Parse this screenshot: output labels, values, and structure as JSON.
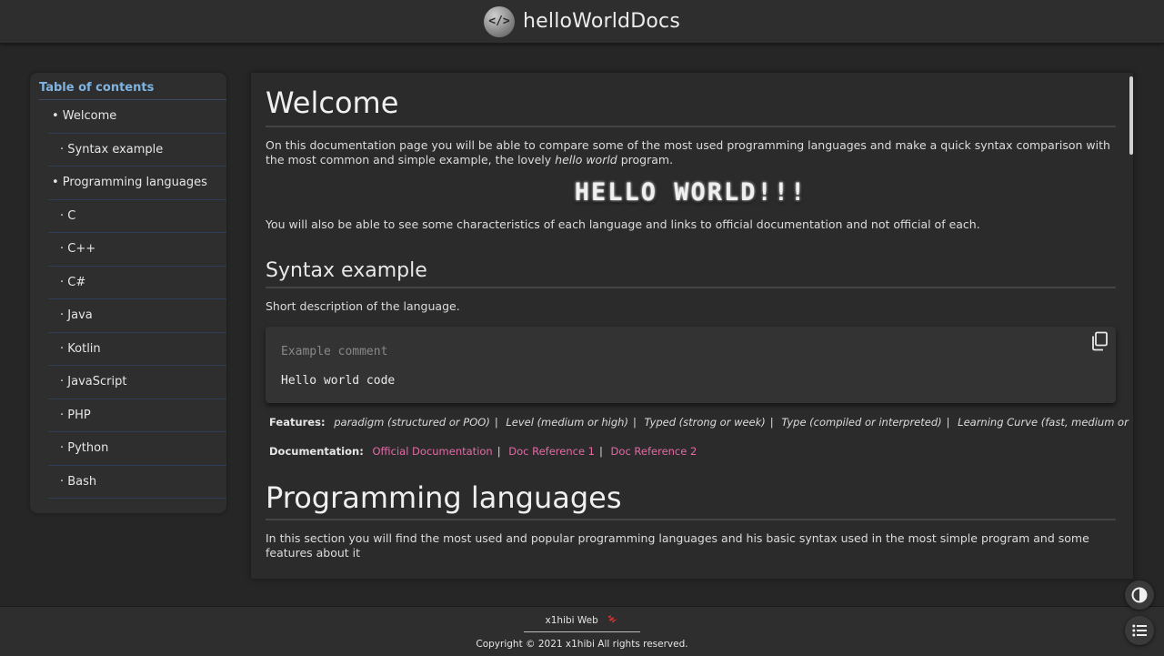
{
  "header": {
    "logo_glyph": "</>",
    "brand": "helloWorldDocs"
  },
  "toc": {
    "title": "Table of contents",
    "items": [
      {
        "label": "• Welcome",
        "level": 1
      },
      {
        "label": "· Syntax example",
        "level": 2
      },
      {
        "label": "• Programming languages",
        "level": 1
      },
      {
        "label": "· C",
        "level": 2
      },
      {
        "label": "· C++",
        "level": 2
      },
      {
        "label": "· C#",
        "level": 2
      },
      {
        "label": "· Java",
        "level": 2
      },
      {
        "label": "· Kotlin",
        "level": 2
      },
      {
        "label": "· JavaScript",
        "level": 2
      },
      {
        "label": "· PHP",
        "level": 2
      },
      {
        "label": "· Python",
        "level": 2
      },
      {
        "label": "· Bash",
        "level": 2
      }
    ]
  },
  "main": {
    "welcome_title": "Welcome",
    "intro_before": "On this documentation page you will be able to compare some of the most used programming languages and make a quick syntax comparison with the most common and simple example, the lovely ",
    "intro_em": "hello world",
    "intro_after": " program.",
    "hello_banner": "HELLO WORLD!!!",
    "intro2": "You will also be able to see some characteristics of each language and links to official documentation and not official of each.",
    "syntax_title": "Syntax example",
    "syntax_desc": "Short description of the language.",
    "code_comment": "Example comment",
    "code_line": "Hello world code",
    "features_label": "Features:",
    "features": [
      "paradigm (structured or POO)",
      "Level (medium or high)",
      "Typed (strong or week)",
      "Type (compiled or interpreted)",
      "Learning Curve (fast, medium or slow)"
    ],
    "docs_label": "Documentation:",
    "docs_links": [
      "Official Documentation",
      "Doc Reference 1",
      "Doc Reference 2"
    ],
    "languages_title": "Programming languages",
    "languages_desc": "In this section you will find the most used and popular programming languages and his basic syntax used in the most simple program and some features about it"
  },
  "footer": {
    "brand": "x1hibi Web",
    "copyright": "Copyright © 2021 x1hibi All rights reserved."
  },
  "icons": {
    "copy": "copy-icon",
    "theme": "contrast-icon",
    "toc_toggle": "list-icon"
  },
  "colors": {
    "link": "#e36aa6",
    "toc_title": "#7fb3e0",
    "footer_mark": "#e0332e"
  }
}
